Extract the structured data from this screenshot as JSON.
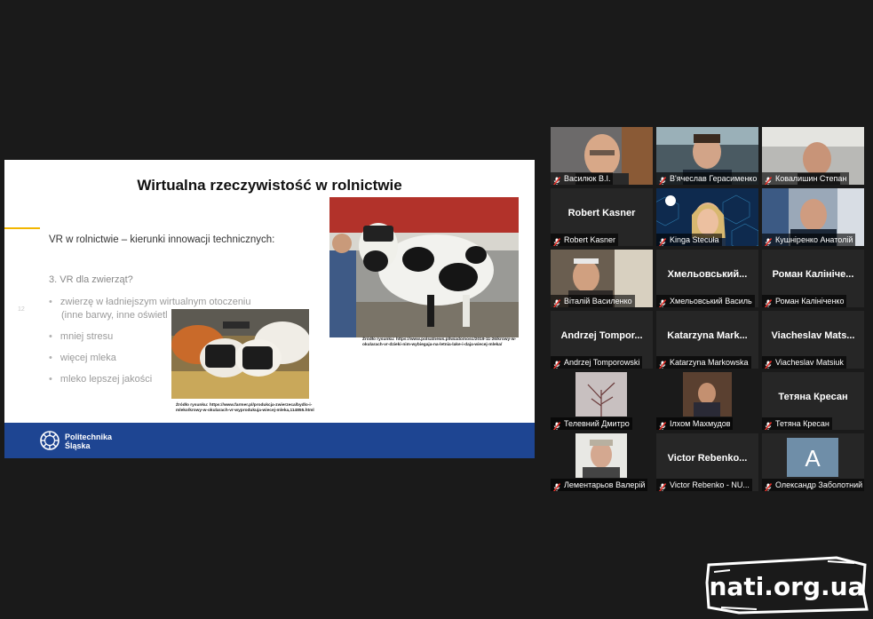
{
  "slide": {
    "title": "Wirtualna rzeczywistość w rolnictwie",
    "subtitle": "VR w rolnictwie – kierunki innowacji technicznych:",
    "slide_number": "12",
    "section_heading": "3. VR dla zwierząt?",
    "bullets": [
      {
        "line1": "zwierzę w ładniejszym wirtualnym otoczeniu",
        "line2": "(inne barwy, inne oświetl"
      },
      {
        "line1": "mniej stresu",
        "line2": ""
      },
      {
        "line1": "więcej mleka",
        "line2": ""
      },
      {
        "line1": "mleko lepszej jakości",
        "line2": ""
      }
    ],
    "caption_1": "Źródło rysunku: https://www.farmer.pl/produkcja-zwierzeca/bydlo-i-mleko/krowy-w-okularach-vr-wyprodukuja-wiecej-mleka,114855.html",
    "caption_2": "Źródło rysunku: https://www.polsatnews.pl/wiadomosc/2019-11-26/krowy-w-okularach-vr-dzieki-nim-wybiegaja-na-letnia-lake-i-daja-wiecej-mleka/",
    "logo_line1": "Politechnika",
    "logo_line2": "Śląska",
    "colors": {
      "footer": "#1e4592",
      "accent": "#f2b600"
    }
  },
  "participants": [
    {
      "name": "Василюк В.І.",
      "center": "",
      "video": "person-bald-glasses"
    },
    {
      "name": "В'ячеслав Герасименко",
      "center": "",
      "video": "person-young-man"
    },
    {
      "name": "Ковалишин Степан",
      "center": "",
      "video": "person-man-room"
    },
    {
      "name": "Robert Kasner",
      "center": "Robert Kasner",
      "video": ""
    },
    {
      "name": "Kinga Stecuła",
      "center": "",
      "video": "person-woman-blonde"
    },
    {
      "name": "Кушніренко Анатолій",
      "center": "",
      "video": "person-man-office"
    },
    {
      "name": "Віталій Василенко",
      "center": "",
      "video": "person-man-phone"
    },
    {
      "name": "Хмельовський Василь",
      "center": "Хмельовський...",
      "video": ""
    },
    {
      "name": "Роман Калініченко",
      "center": "Роман Калініче...",
      "video": ""
    },
    {
      "name": "Andrzej Tomporowski",
      "center": "Andrzej Tompor...",
      "video": ""
    },
    {
      "name": "Katarzyna Markowska",
      "center": "Katarzyna Mark...",
      "video": ""
    },
    {
      "name": "Viacheslav Matsiuk",
      "center": "Viacheslav Mats...",
      "video": ""
    },
    {
      "name": "Телевний Дмитро",
      "center": "",
      "video": "winter-tree"
    },
    {
      "name": "Ілхом Махмудов",
      "center": "",
      "video": "person-man-suit"
    },
    {
      "name": "Тетяна Кресан",
      "center": "Тетяна Кресан",
      "video": ""
    },
    {
      "name": "Лементарьов Валерій",
      "center": "",
      "video": "person-portrait"
    },
    {
      "name": "Victor Rebenko - NU...",
      "center": "Victor Rebenko...",
      "video": ""
    },
    {
      "name": "Олександр Заболотний",
      "center": "",
      "avatar_letter": "A",
      "video": "avatar"
    }
  ],
  "watermark": "nati.org.ua",
  "icons": {
    "mic": "microphone-muted-icon"
  }
}
